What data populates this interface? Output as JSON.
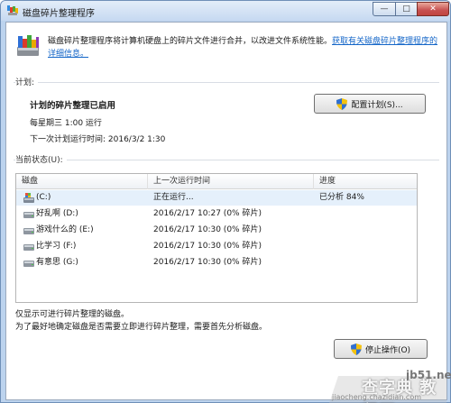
{
  "window": {
    "title": "磁盘碎片整理程序",
    "minimize_glyph": "—",
    "maximize_glyph": "□",
    "close_glyph": "✕"
  },
  "description": {
    "text": "磁盘碎片整理程序将计算机硬盘上的碎片文件进行合并，以改进文件系统性能。",
    "link": "获取有关磁盘碎片整理程序的详细信息。"
  },
  "schedule": {
    "section_label": "计划:",
    "title": "计划的碎片整理已启用",
    "line1": "每星期三 1:00 运行",
    "line2": "下一次计划运行时间: 2016/3/2 1:30",
    "configure_button": "配置计划(S)..."
  },
  "status": {
    "section_label": "当前状态(U):",
    "columns": [
      "磁盘",
      "上一次运行时间",
      "进度"
    ],
    "rows": [
      {
        "disk": "(C:)",
        "last_run": "正在运行...",
        "progress": "已分析 84%",
        "icon": "system-drive-icon"
      },
      {
        "disk": "好乱啊 (D:)",
        "last_run": "2016/2/17 10:27 (0% 碎片)",
        "progress": "",
        "icon": "drive-icon"
      },
      {
        "disk": "游戏什么的 (E:)",
        "last_run": "2016/2/17 10:30 (0% 碎片)",
        "progress": "",
        "icon": "drive-icon"
      },
      {
        "disk": "比学习 (F:)",
        "last_run": "2016/2/17 10:30 (0% 碎片)",
        "progress": "",
        "icon": "drive-icon"
      },
      {
        "disk": "有意思 (G:)",
        "last_run": "2016/2/17 10:30 (0% 碎片)",
        "progress": "",
        "icon": "drive-icon"
      }
    ]
  },
  "notes": {
    "line1": "仅显示可进行碎片整理的磁盘。",
    "line2": "为了最好地确定磁盘是否需要立即进行碎片整理，需要首先分析磁盘。"
  },
  "actions": {
    "stop_button": "停止操作(O)"
  },
  "watermark": {
    "site": "jb51.net",
    "name": "查字典 教程网",
    "url": "jiaocheng.chazidian.com"
  },
  "colors": {
    "link": "#1466c8",
    "selected_row": "#e5f0fb",
    "titlebar": "#c6d9f1"
  }
}
